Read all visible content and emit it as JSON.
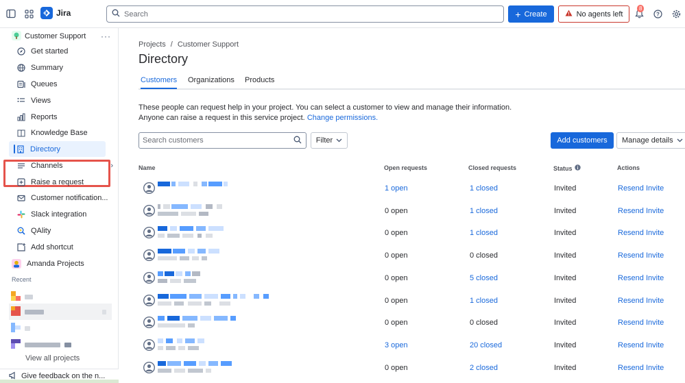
{
  "app": {
    "name": "Jira",
    "brand_color": "#1868db"
  },
  "topbar": {
    "search_placeholder": "Search",
    "create_label": "Create",
    "no_agents_label": "No agents left",
    "notification_count": "8"
  },
  "sidebar": {
    "project_name": "Customer Support",
    "items": [
      {
        "label": "Get started",
        "icon": "compass-icon"
      },
      {
        "label": "Summary",
        "icon": "globe-icon"
      },
      {
        "label": "Queues",
        "icon": "queues-icon"
      },
      {
        "label": "Views",
        "icon": "list-icon"
      },
      {
        "label": "Reports",
        "icon": "chart-icon"
      },
      {
        "label": "Knowledge Base",
        "icon": "book-icon"
      },
      {
        "label": "Directory",
        "icon": "building-icon",
        "active": true
      },
      {
        "label": "Channels",
        "icon": "channels-icon"
      },
      {
        "label": "Raise a request",
        "icon": "plus-square-icon"
      },
      {
        "label": "Customer notification...",
        "icon": "mail-icon"
      },
      {
        "label": "Slack integration",
        "icon": "slack-icon"
      },
      {
        "label": "QAlity",
        "icon": "qality-icon"
      },
      {
        "label": "Add shortcut",
        "icon": "add-shortcut-icon"
      }
    ],
    "other_project": "Amanda Projects",
    "recent_label": "Recent",
    "view_all_label": "View all projects",
    "feedback_label": "Give feedback on the n..."
  },
  "main": {
    "breadcrumb": {
      "root": "Projects",
      "separator": "/",
      "current": "Customer Support"
    },
    "title": "Directory",
    "tabs": [
      "Customers",
      "Organizations",
      "Products"
    ],
    "description_line1": "These people can request help in your project. You can select a customer to view and manage their information.",
    "description_line2": "Anyone can raise a request in this service project.",
    "change_permissions_link": "Change permissions.",
    "search_placeholder": "Search customers",
    "filter_label": "Filter",
    "add_customers_label": "Add customers",
    "manage_details_label": "Manage details",
    "table": {
      "headers": [
        "Name",
        "Open requests",
        "Closed requests",
        "Status",
        "Actions"
      ],
      "rows": [
        {
          "open": "1 open",
          "closed": "1 closed",
          "status": "Invited",
          "action": "Resend Invite",
          "open_link": true,
          "closed_link": true
        },
        {
          "open": "0 open",
          "closed": "1 closed",
          "status": "Invited",
          "action": "Resend Invite",
          "open_link": false,
          "closed_link": true
        },
        {
          "open": "0 open",
          "closed": "1 closed",
          "status": "Invited",
          "action": "Resend Invite",
          "open_link": false,
          "closed_link": true
        },
        {
          "open": "0 open",
          "closed": "0 closed",
          "status": "Invited",
          "action": "Resend Invite",
          "open_link": false,
          "closed_link": false
        },
        {
          "open": "0 open",
          "closed": "5 closed",
          "status": "Invited",
          "action": "Resend Invite",
          "open_link": false,
          "closed_link": true
        },
        {
          "open": "0 open",
          "closed": "1 closed",
          "status": "Invited",
          "action": "Resend Invite",
          "open_link": false,
          "closed_link": true
        },
        {
          "open": "0 open",
          "closed": "0 closed",
          "status": "Invited",
          "action": "Resend Invite",
          "open_link": false,
          "closed_link": false
        },
        {
          "open": "3 open",
          "closed": "20 closed",
          "status": "Invited",
          "action": "Resend Invite",
          "open_link": true,
          "closed_link": true
        },
        {
          "open": "0 open",
          "closed": "2 closed",
          "status": "Invited",
          "action": "Resend Invite",
          "open_link": false,
          "closed_link": true
        }
      ]
    }
  },
  "colors": {
    "accent": "#1868db",
    "danger": "#c9372c",
    "highlight_box": "#e5534b",
    "active_bg": "#e9f2fe"
  }
}
